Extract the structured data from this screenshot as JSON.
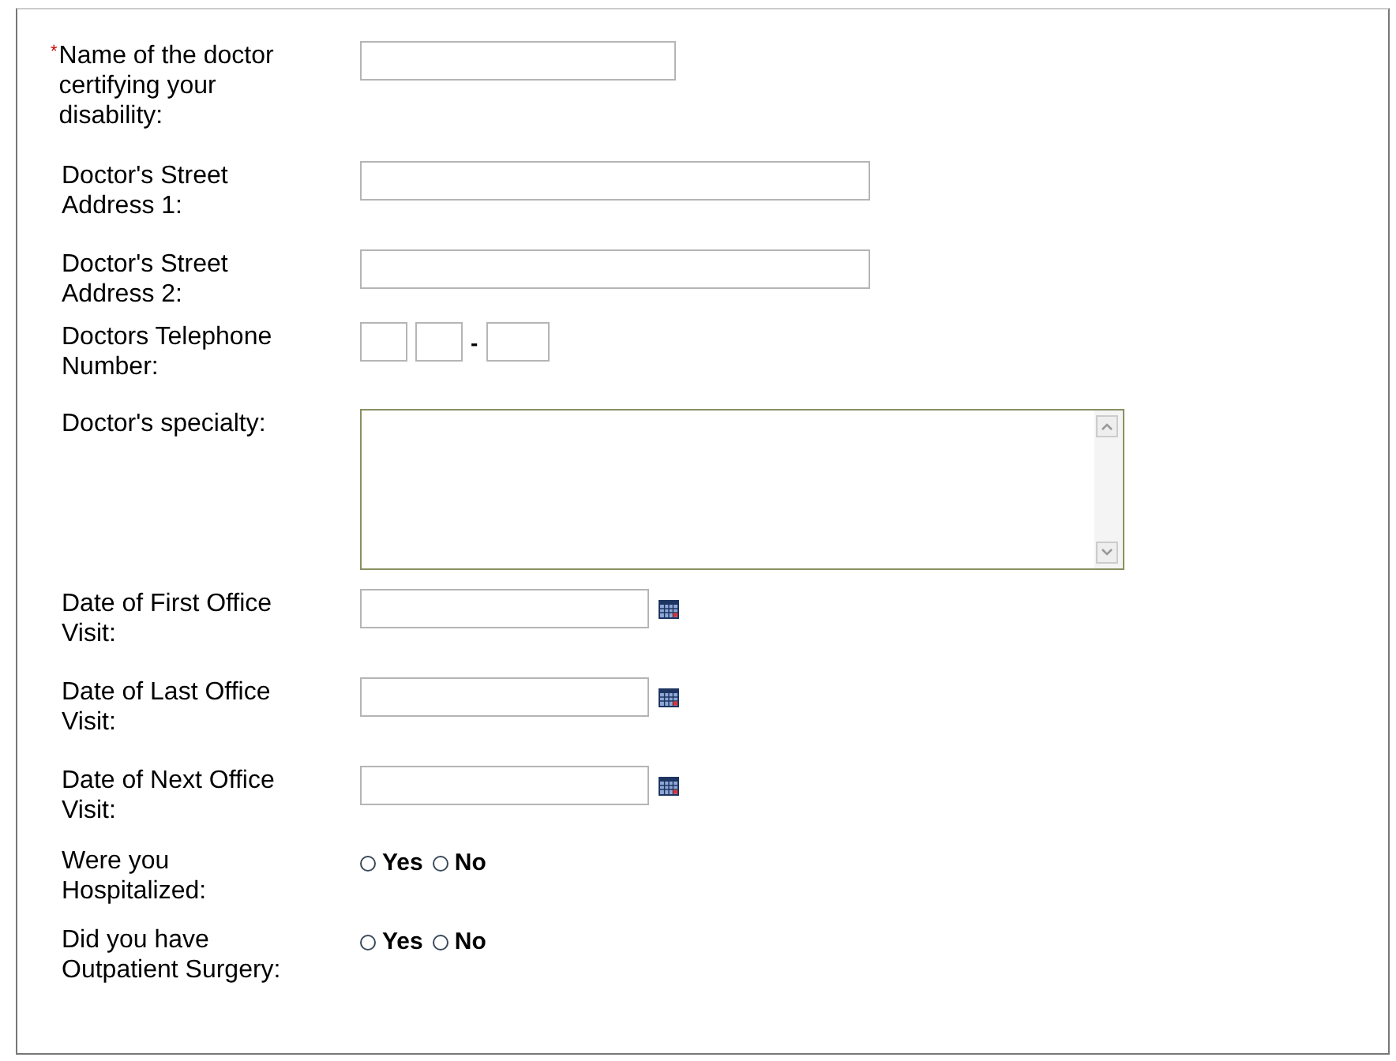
{
  "fields": [
    {
      "kind": "text",
      "label": "Name of the doctor certifying your disability:",
      "required_mark": "*"
    },
    {
      "kind": "text",
      "label": "Doctor's Street Address 1:"
    },
    {
      "kind": "text",
      "label": "Doctor's Street Address 2:"
    },
    {
      "kind": "phone",
      "label": "Doctors Telephone Number:",
      "separator": "-"
    },
    {
      "kind": "textarea",
      "label": "Doctor's specialty:"
    },
    {
      "kind": "date",
      "label": "Date of First Office Visit:"
    },
    {
      "kind": "date",
      "label": "Date of Last Office Visit:"
    },
    {
      "kind": "date",
      "label": "Date of Next Office Visit:"
    },
    {
      "kind": "radio",
      "label": "Were you Hospitalized:",
      "options": [
        {
          "label": "Yes",
          "selected": false
        },
        {
          "label": "No",
          "selected": false
        }
      ]
    },
    {
      "kind": "radio",
      "label": "Did you have Outpatient Surgery:",
      "options": [
        {
          "label": "Yes",
          "selected": false
        },
        {
          "label": "No",
          "selected": false
        }
      ]
    }
  ]
}
